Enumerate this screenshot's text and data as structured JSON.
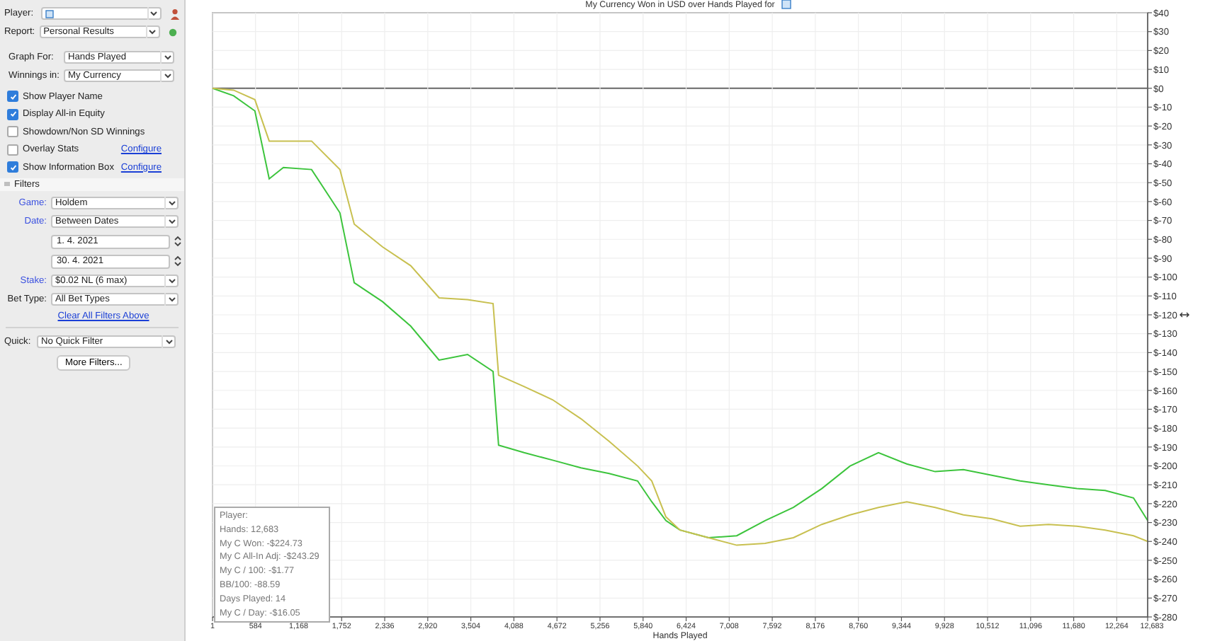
{
  "sidebar": {
    "player": {
      "label": "Player:"
    },
    "report": {
      "label": "Report:",
      "value": "Personal Results"
    },
    "graph_for": {
      "label": "Graph For:",
      "value": "Hands Played"
    },
    "winnings_in": {
      "label": "Winnings in:",
      "value": "My Currency"
    },
    "options": [
      {
        "label": "Show Player Name",
        "checked": true
      },
      {
        "label": "Display All-in Equity",
        "checked": true
      },
      {
        "label": "Showdown/Non SD Winnings",
        "checked": false
      },
      {
        "label": "Overlay Stats",
        "checked": false,
        "link": "Configure"
      },
      {
        "label": "Show Information Box",
        "checked": true,
        "link": "Configure"
      }
    ],
    "filters_header": "Filters",
    "filters": [
      {
        "kind": "select",
        "label": "Game:",
        "active": true,
        "value": "Holdem"
      },
      {
        "kind": "select",
        "label": "Date:",
        "active": true,
        "value": "Between Dates"
      },
      {
        "kind": "spinner",
        "value": "1. 4. 2021"
      },
      {
        "kind": "spinner",
        "value": "30. 4. 2021"
      },
      {
        "kind": "select",
        "label": "Stake:",
        "active": true,
        "value": "$0.02 NL (6 max)"
      },
      {
        "kind": "select",
        "label": "Bet Type:",
        "active": false,
        "value": "All Bet Types"
      }
    ],
    "clear_link": "Clear All Filters Above",
    "quick": {
      "label": "Quick:",
      "value": "No Quick Filter"
    },
    "more_button": "More Filters..."
  },
  "chart": {
    "info_box": [
      "Player:",
      "Hands: 12,683",
      "My C Won: -$224.73",
      "My C All-In Adj: -$243.29",
      "My C / 100: -$1.77",
      "BB/100: -88.59",
      "Days Played: 14",
      "My C / Day: -$16.05"
    ],
    "chart_data": {
      "type": "line",
      "title": "My Currency Won in USD over Hands Played for",
      "xlabel": "Hands Played",
      "x": [
        1,
        288,
        576,
        769,
        961,
        1345,
        1729,
        1922,
        2306,
        2690,
        3074,
        3459,
        3805,
        3881,
        4227,
        4612,
        4996,
        5380,
        5765,
        5957,
        6149,
        6341,
        6726,
        7110,
        7494,
        7879,
        8263,
        8647,
        9032,
        9416,
        9800,
        10185,
        10569,
        10953,
        11338,
        11722,
        12106,
        12490,
        12683
      ],
      "series": [
        {
          "color": "#3cc43c",
          "values": [
            0,
            -4,
            -12,
            -48,
            -42,
            -43,
            -66,
            -103,
            -113,
            -126,
            -144,
            -141,
            -150,
            -189,
            -193,
            -197,
            -201,
            -204,
            -208,
            -219,
            -229,
            -234,
            -238,
            -237,
            -229,
            -222,
            -212,
            -200,
            -193,
            -199,
            -203,
            -202,
            -205,
            -208,
            -210,
            -212,
            -213,
            -217,
            -229
          ]
        },
        {
          "color": "#c8c050",
          "values": [
            0,
            -1,
            -6,
            -28,
            -28,
            -28,
            -43,
            -72,
            -84,
            -94,
            -111,
            -112,
            -114,
            -152,
            -158,
            -165,
            -175,
            -187,
            -200,
            -208,
            -227,
            -234,
            -238,
            -242,
            -241,
            -238,
            -231,
            -226,
            -222,
            -219,
            -222,
            -226,
            -228,
            -232,
            -231,
            -232,
            -234,
            -237,
            -240
          ]
        }
      ],
      "xlim": [
        1,
        12683
      ],
      "ylim": [
        -280,
        40
      ],
      "grid": true,
      "xticks": [
        1,
        584,
        {
          "value": 1168,
          "label": "1,168"
        },
        {
          "value": 1752,
          "label": "1,752"
        },
        {
          "value": 2336,
          "label": "2,336"
        },
        {
          "value": 2920,
          "label": "2,920"
        },
        {
          "value": 3504,
          "label": "3,504"
        },
        {
          "value": 4088,
          "label": "4,088"
        },
        {
          "value": 4672,
          "label": "4,672"
        },
        {
          "value": 5256,
          "label": "5,256"
        },
        {
          "value": 5840,
          "label": "5,840"
        },
        {
          "value": 6424,
          "label": "6,424"
        },
        {
          "value": 7008,
          "label": "7,008"
        },
        {
          "value": 7592,
          "label": "7,592"
        },
        {
          "value": 8176,
          "label": "8,176"
        },
        {
          "value": 8760,
          "label": "8,760"
        },
        {
          "value": 9344,
          "label": "9,344"
        },
        {
          "value": 9928,
          "label": "9,928"
        },
        {
          "value": 10512,
          "label": "10,512"
        },
        {
          "value": 11096,
          "label": "11,096"
        },
        {
          "value": 11680,
          "label": "11,680"
        },
        {
          "value": 12264,
          "label": "12,264"
        },
        {
          "value": 12683,
          "label": "12,683"
        }
      ],
      "yticks": [
        {
          "value": 40,
          "label": "$40"
        },
        {
          "value": 30,
          "label": "$30"
        },
        {
          "value": 20,
          "label": "$20"
        },
        {
          "value": 10,
          "label": "$10"
        },
        {
          "value": 0,
          "label": "$0"
        },
        {
          "value": -10,
          "label": "$-10"
        },
        {
          "value": -20,
          "label": "$-20"
        },
        {
          "value": -30,
          "label": "$-30"
        },
        {
          "value": -40,
          "label": "$-40"
        },
        {
          "value": -50,
          "label": "$-50"
        },
        {
          "value": -60,
          "label": "$-60"
        },
        {
          "value": -70,
          "label": "$-70"
        },
        {
          "value": -80,
          "label": "$-80"
        },
        {
          "value": -90,
          "label": "$-90"
        },
        {
          "value": -100,
          "label": "$-100"
        },
        {
          "value": -110,
          "label": "$-110"
        },
        {
          "value": -120,
          "label": "$-120"
        },
        {
          "value": -130,
          "label": "$-130"
        },
        {
          "value": -140,
          "label": "$-140"
        },
        {
          "value": -150,
          "label": "$-150"
        },
        {
          "value": -160,
          "label": "$-160"
        },
        {
          "value": -170,
          "label": "$-170"
        },
        {
          "value": -180,
          "label": "$-180"
        },
        {
          "value": -190,
          "label": "$-190"
        },
        {
          "value": -200,
          "label": "$-200"
        },
        {
          "value": -210,
          "label": "$-210"
        },
        {
          "value": -220,
          "label": "$-220"
        },
        {
          "value": -230,
          "label": "$-230"
        },
        {
          "value": -240,
          "label": "$-240"
        },
        {
          "value": -250,
          "label": "$-250"
        },
        {
          "value": -260,
          "label": "$-260"
        },
        {
          "value": -270,
          "label": "$-270"
        },
        {
          "value": -280,
          "label": "$-280"
        }
      ]
    }
  }
}
